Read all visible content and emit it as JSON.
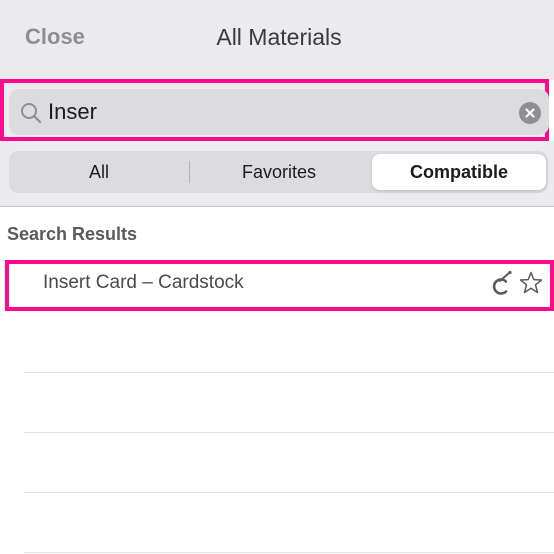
{
  "header": {
    "close_label": "Close",
    "title": "All Materials"
  },
  "search": {
    "value": "Inser",
    "placeholder": "Search"
  },
  "segments": [
    {
      "label": "All",
      "selected": false
    },
    {
      "label": "Favorites",
      "selected": false
    },
    {
      "label": "Compatible",
      "selected": true
    }
  ],
  "results": {
    "section_title": "Search Results",
    "items": [
      {
        "label": "Insert Card –  Cardstock",
        "icons": [
          "cricut-cut-icon",
          "star-outline-icon"
        ],
        "favorite": false
      }
    ]
  },
  "colors": {
    "highlight": "#ff0a8c",
    "header_bg": "#ebebed",
    "text_primary": "#1c1c1e",
    "text_secondary": "#8e8e93"
  }
}
